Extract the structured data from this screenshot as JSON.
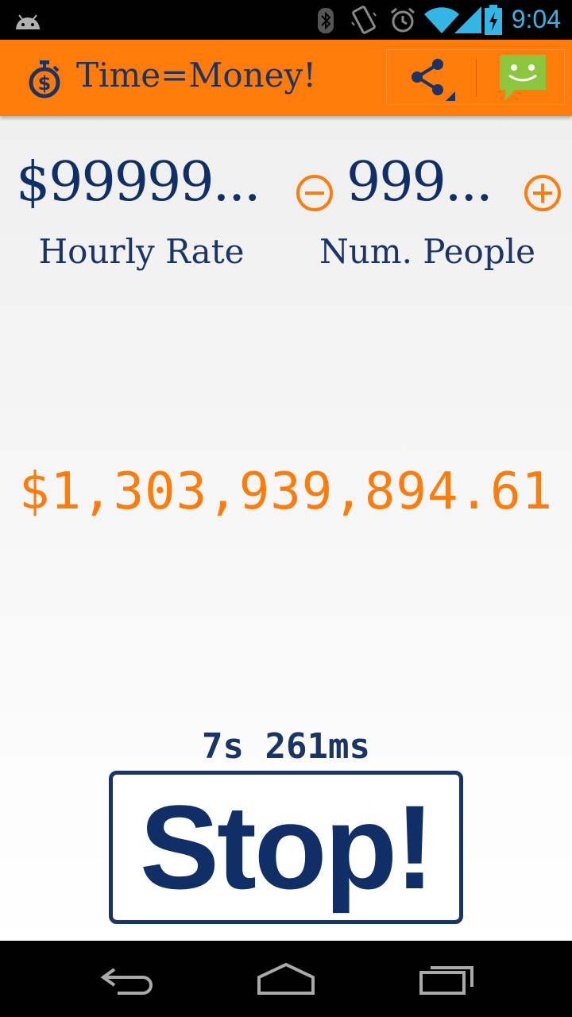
{
  "status_bar": {
    "time": "9:04",
    "icons": [
      "android-icon",
      "bluetooth-icon",
      "vibrate-icon",
      "alarm-icon",
      "wifi-icon",
      "signal-icon",
      "battery-charging-icon"
    ]
  },
  "action_bar": {
    "title": "Time=Money!",
    "app_icon": "stopwatch-dollar-icon",
    "share_icon": "share-icon",
    "feedback_icon": "chat-smiley-icon"
  },
  "rate": {
    "value": "$99999...",
    "label": "Hourly Rate"
  },
  "people": {
    "value": "999...",
    "label": "Num. People",
    "decrement_icon": "minus-circle-icon",
    "increment_icon": "plus-circle-icon"
  },
  "total_cost": "$1,303,939,894.61",
  "elapsed_time": "7s 261ms",
  "stop_button_label": "Stop!",
  "nav_bar": {
    "icons": [
      "back-icon",
      "home-icon",
      "recents-icon"
    ]
  },
  "colors": {
    "accent": "#ff7b0a",
    "primary_text": "#1a3466",
    "status_icon": "#33b5e5"
  }
}
